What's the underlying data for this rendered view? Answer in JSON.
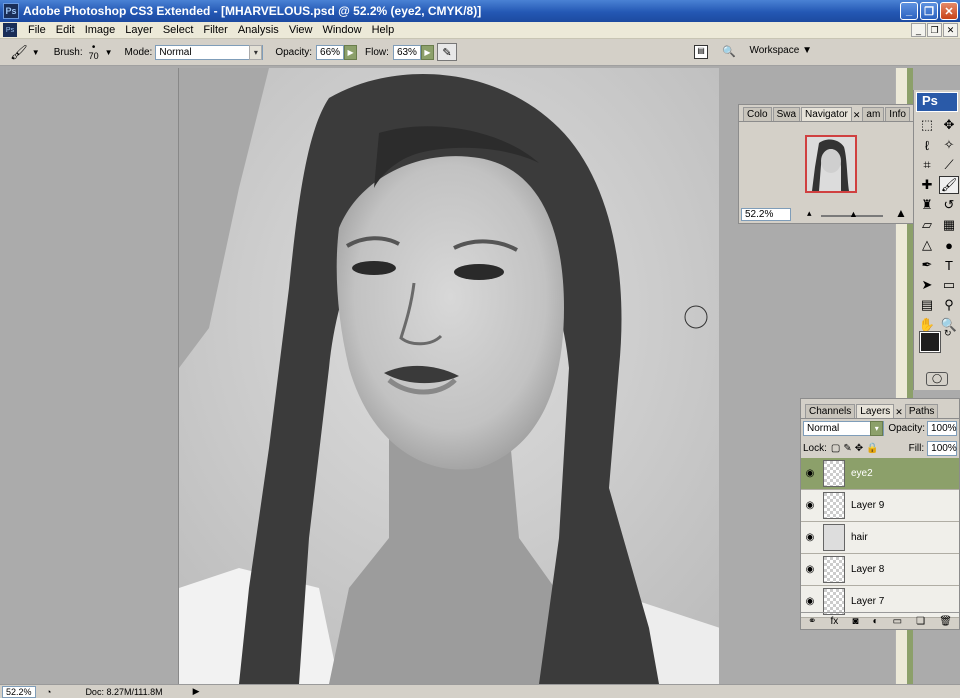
{
  "app": {
    "title": "Adobe Photoshop CS3 Extended - [MHARVELOUS.psd @ 52.2% (eye2, CMYK/8)]",
    "ps_logo": "Ps"
  },
  "menu": [
    "File",
    "Edit",
    "Image",
    "Layer",
    "Select",
    "Filter",
    "Analysis",
    "View",
    "Window",
    "Help"
  ],
  "options": {
    "brush_label": "Brush:",
    "brush_size": "70",
    "mode_label": "Mode:",
    "mode_value": "Normal",
    "opacity_label": "Opacity:",
    "opacity_value": "66%",
    "flow_label": "Flow:",
    "flow_value": "63%",
    "workspace_label": "Workspace"
  },
  "navigator": {
    "tabs": [
      "Colo",
      "Swa",
      "Navigator",
      "am",
      "Info"
    ],
    "zoom_value": "52.2%"
  },
  "toolbox": {
    "header": "Ps"
  },
  "layers_panel": {
    "tabs": [
      "Channels",
      "Layers",
      "Paths"
    ],
    "blend_mode": "Normal",
    "opacity_label": "Opacity:",
    "opacity_value": "100%",
    "lock_label": "Lock:",
    "fill_label": "Fill:",
    "fill_value": "100%",
    "layers": [
      {
        "name": "eye2",
        "active": true
      },
      {
        "name": "Layer 9",
        "active": false
      },
      {
        "name": "hair",
        "active": false
      },
      {
        "name": "Layer 8",
        "active": false
      },
      {
        "name": "Layer 7",
        "active": false
      }
    ]
  },
  "status": {
    "zoom": "52.2%",
    "doc": "Doc: 8.27M/111.8M"
  },
  "colors": {
    "accent_green": "#8ca06a",
    "title_blue": "#2458b4"
  }
}
